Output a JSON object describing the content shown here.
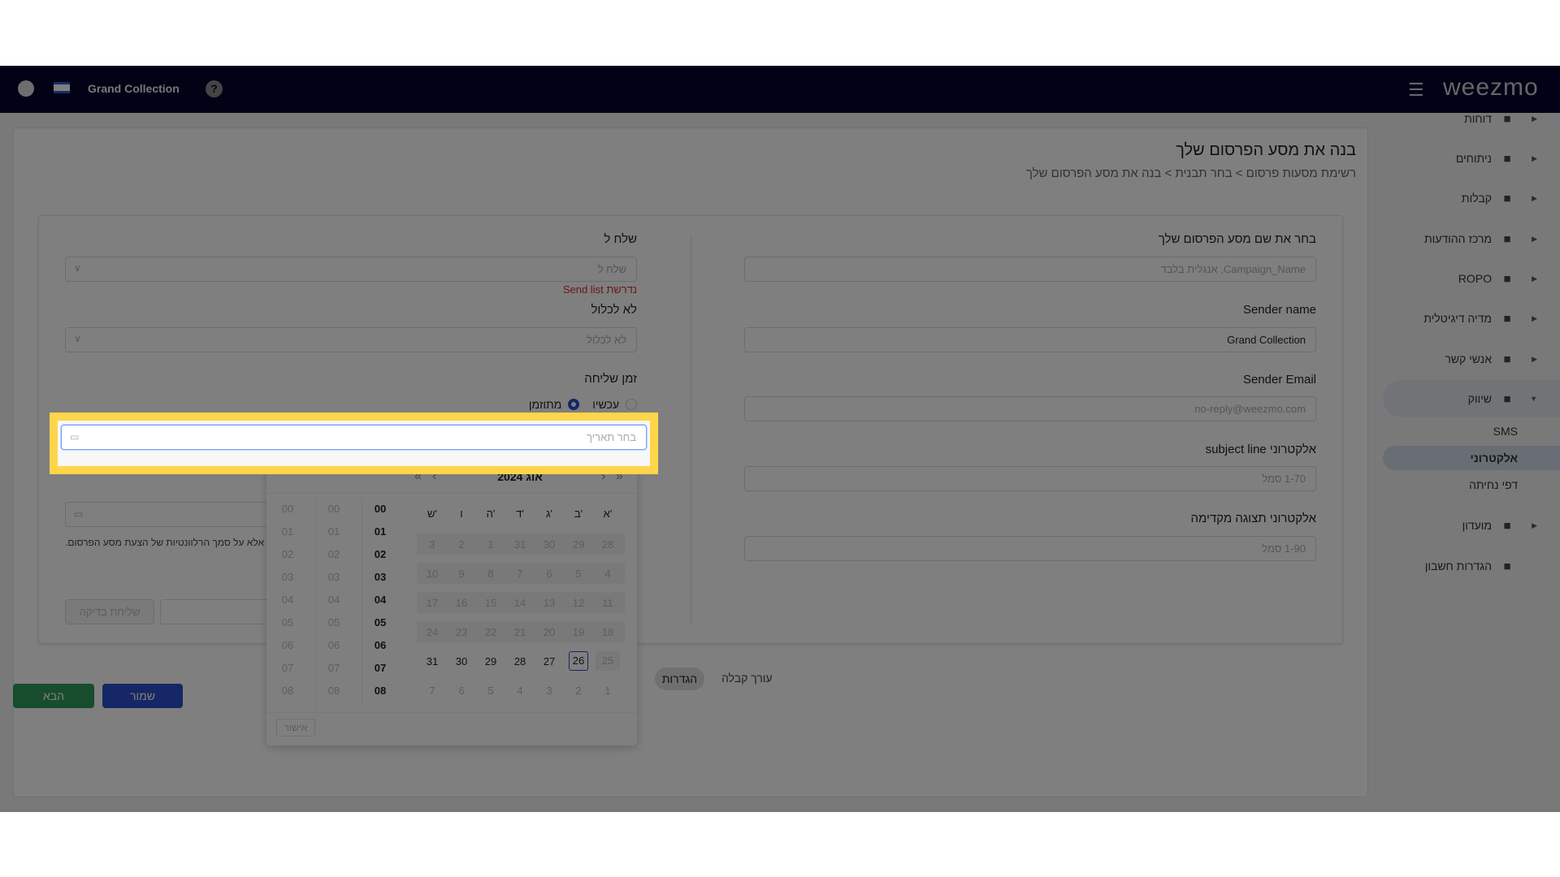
{
  "header": {
    "brand": "weezmo",
    "account_name": "Grand Collection",
    "brand_color": "#1db954"
  },
  "sidebar": {
    "items": [
      {
        "label": "דוחות",
        "icon": "dashboard-icon"
      },
      {
        "label": "ניתוחים",
        "icon": "bar-chart-icon"
      },
      {
        "label": "קבלות",
        "icon": "receipt-icon"
      },
      {
        "label": "מרכז ההודעות",
        "icon": "message-icon"
      },
      {
        "label": "ROPO",
        "icon": "infinity-icon"
      },
      {
        "label": "מדיה דיגיטלית",
        "icon": "people-icon"
      },
      {
        "label": "אנשי קשר",
        "icon": "contacts-icon"
      },
      {
        "label": "שיווק",
        "icon": "party-popper-icon",
        "active": true
      }
    ],
    "sub_items": [
      {
        "label": "SMS"
      },
      {
        "label": "אלקטרוני",
        "active": true
      },
      {
        "label": "דפי נחיתה"
      }
    ],
    "bottom_items": [
      {
        "label": "מועדון",
        "icon": "tag-icon"
      },
      {
        "label": "הגדרות חשבון",
        "icon": "gear-icon"
      }
    ]
  },
  "page": {
    "title": "בנה את מסע הפרסום שלך",
    "breadcrumb": [
      "רשימת מסעות פרסום",
      "בחר תבנית",
      "בנה את מסע הפרסום שלך"
    ],
    "breadcrumb_sep": ">"
  },
  "form": {
    "campaign_name_label": "בחר את שם מסע הפרסום שלך",
    "campaign_name_placeholder": "Campaign_Name, אנגלית בלבד",
    "sender_name_label": "Sender name",
    "sender_name_value": "Grand Collection",
    "sender_email_label": "Sender Email",
    "sender_email_placeholder": "no-reply@weezmo.com",
    "subject_label": "אלקטרוני subject line",
    "subject_placeholder": "1-70 סמל",
    "preview_label": "אלקטרוני תצוגה מקדימה",
    "preview_placeholder": "1-90 סמל",
    "send_to_label": "שלח ל",
    "send_to_placeholder": "שלח ל",
    "send_to_error": "נדרשת Send list",
    "exclude_label": "לא לכלול",
    "exclude_placeholder": "לא לכלול",
    "send_time_label": "זמן שליחה",
    "radio_now": "עכשיו",
    "radio_scheduled": "מתוזמן",
    "radio_selected": "scheduled",
    "date_placeholder": "בחר תאריך",
    "note": "אלא על סמך הרלוונטיות של הצעת מסע הפרסום.",
    "test_send_button": "שליחת בדיקה"
  },
  "calendar": {
    "month_year": "אוג 2024",
    "weekdays": [
      "א'",
      "ב'",
      "ג'",
      "ד'",
      "ה'",
      "ו",
      "ש'"
    ],
    "weeks": [
      [
        28,
        29,
        30,
        31,
        1,
        2,
        3
      ],
      [
        4,
        5,
        6,
        7,
        8,
        9,
        10
      ],
      [
        11,
        12,
        13,
        14,
        15,
        16,
        17
      ],
      [
        18,
        19,
        20,
        21,
        22,
        23,
        24
      ],
      [
        25,
        26,
        27,
        28,
        29,
        30,
        31
      ],
      [
        1,
        2,
        3,
        4,
        5,
        6,
        7
      ]
    ],
    "selected_day": 26,
    "hours": [
      "00",
      "01",
      "02",
      "03",
      "04",
      "05",
      "06",
      "07",
      "08"
    ],
    "minutes": [
      "00",
      "01",
      "02",
      "03",
      "04",
      "05",
      "06",
      "07",
      "08"
    ],
    "seconds": [
      "00",
      "01",
      "02",
      "03",
      "04",
      "05",
      "06",
      "07",
      "08"
    ],
    "ok_button": "אישור"
  },
  "tabs": [
    {
      "label": "הגדרות",
      "active": true
    },
    {
      "label": "עורך קבלה"
    }
  ],
  "actions": {
    "save": "שמור",
    "next": "הבא",
    "save_color": "#2a4fc9",
    "next_color": "#2e9a5a"
  }
}
